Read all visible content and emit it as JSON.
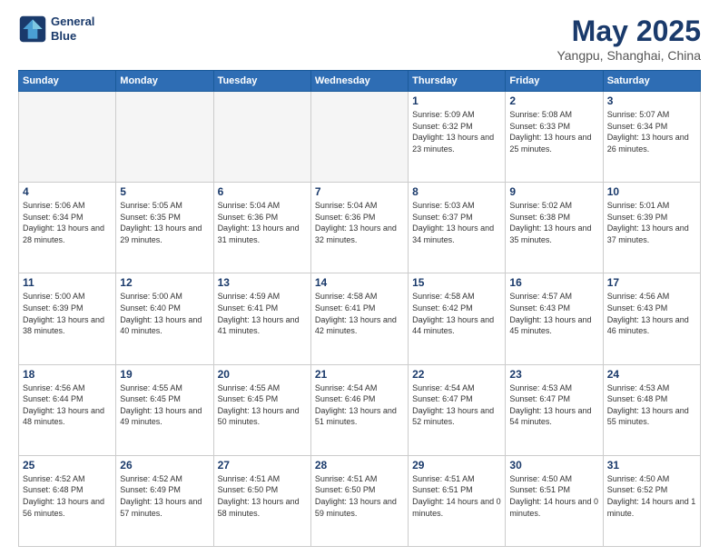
{
  "header": {
    "logo_line1": "General",
    "logo_line2": "Blue",
    "month": "May 2025",
    "location": "Yangpu, Shanghai, China"
  },
  "weekdays": [
    "Sunday",
    "Monday",
    "Tuesday",
    "Wednesday",
    "Thursday",
    "Friday",
    "Saturday"
  ],
  "weeks": [
    [
      {
        "day": "",
        "empty": true
      },
      {
        "day": "",
        "empty": true
      },
      {
        "day": "",
        "empty": true
      },
      {
        "day": "",
        "empty": true
      },
      {
        "day": "1",
        "sunrise": "Sunrise: 5:09 AM",
        "sunset": "Sunset: 6:32 PM",
        "daylight": "Daylight: 13 hours and 23 minutes."
      },
      {
        "day": "2",
        "sunrise": "Sunrise: 5:08 AM",
        "sunset": "Sunset: 6:33 PM",
        "daylight": "Daylight: 13 hours and 25 minutes."
      },
      {
        "day": "3",
        "sunrise": "Sunrise: 5:07 AM",
        "sunset": "Sunset: 6:34 PM",
        "daylight": "Daylight: 13 hours and 26 minutes."
      }
    ],
    [
      {
        "day": "4",
        "sunrise": "Sunrise: 5:06 AM",
        "sunset": "Sunset: 6:34 PM",
        "daylight": "Daylight: 13 hours and 28 minutes."
      },
      {
        "day": "5",
        "sunrise": "Sunrise: 5:05 AM",
        "sunset": "Sunset: 6:35 PM",
        "daylight": "Daylight: 13 hours and 29 minutes."
      },
      {
        "day": "6",
        "sunrise": "Sunrise: 5:04 AM",
        "sunset": "Sunset: 6:36 PM",
        "daylight": "Daylight: 13 hours and 31 minutes."
      },
      {
        "day": "7",
        "sunrise": "Sunrise: 5:04 AM",
        "sunset": "Sunset: 6:36 PM",
        "daylight": "Daylight: 13 hours and 32 minutes."
      },
      {
        "day": "8",
        "sunrise": "Sunrise: 5:03 AM",
        "sunset": "Sunset: 6:37 PM",
        "daylight": "Daylight: 13 hours and 34 minutes."
      },
      {
        "day": "9",
        "sunrise": "Sunrise: 5:02 AM",
        "sunset": "Sunset: 6:38 PM",
        "daylight": "Daylight: 13 hours and 35 minutes."
      },
      {
        "day": "10",
        "sunrise": "Sunrise: 5:01 AM",
        "sunset": "Sunset: 6:39 PM",
        "daylight": "Daylight: 13 hours and 37 minutes."
      }
    ],
    [
      {
        "day": "11",
        "sunrise": "Sunrise: 5:00 AM",
        "sunset": "Sunset: 6:39 PM",
        "daylight": "Daylight: 13 hours and 38 minutes."
      },
      {
        "day": "12",
        "sunrise": "Sunrise: 5:00 AM",
        "sunset": "Sunset: 6:40 PM",
        "daylight": "Daylight: 13 hours and 40 minutes."
      },
      {
        "day": "13",
        "sunrise": "Sunrise: 4:59 AM",
        "sunset": "Sunset: 6:41 PM",
        "daylight": "Daylight: 13 hours and 41 minutes."
      },
      {
        "day": "14",
        "sunrise": "Sunrise: 4:58 AM",
        "sunset": "Sunset: 6:41 PM",
        "daylight": "Daylight: 13 hours and 42 minutes."
      },
      {
        "day": "15",
        "sunrise": "Sunrise: 4:58 AM",
        "sunset": "Sunset: 6:42 PM",
        "daylight": "Daylight: 13 hours and 44 minutes."
      },
      {
        "day": "16",
        "sunrise": "Sunrise: 4:57 AM",
        "sunset": "Sunset: 6:43 PM",
        "daylight": "Daylight: 13 hours and 45 minutes."
      },
      {
        "day": "17",
        "sunrise": "Sunrise: 4:56 AM",
        "sunset": "Sunset: 6:43 PM",
        "daylight": "Daylight: 13 hours and 46 minutes."
      }
    ],
    [
      {
        "day": "18",
        "sunrise": "Sunrise: 4:56 AM",
        "sunset": "Sunset: 6:44 PM",
        "daylight": "Daylight: 13 hours and 48 minutes."
      },
      {
        "day": "19",
        "sunrise": "Sunrise: 4:55 AM",
        "sunset": "Sunset: 6:45 PM",
        "daylight": "Daylight: 13 hours and 49 minutes."
      },
      {
        "day": "20",
        "sunrise": "Sunrise: 4:55 AM",
        "sunset": "Sunset: 6:45 PM",
        "daylight": "Daylight: 13 hours and 50 minutes."
      },
      {
        "day": "21",
        "sunrise": "Sunrise: 4:54 AM",
        "sunset": "Sunset: 6:46 PM",
        "daylight": "Daylight: 13 hours and 51 minutes."
      },
      {
        "day": "22",
        "sunrise": "Sunrise: 4:54 AM",
        "sunset": "Sunset: 6:47 PM",
        "daylight": "Daylight: 13 hours and 52 minutes."
      },
      {
        "day": "23",
        "sunrise": "Sunrise: 4:53 AM",
        "sunset": "Sunset: 6:47 PM",
        "daylight": "Daylight: 13 hours and 54 minutes."
      },
      {
        "day": "24",
        "sunrise": "Sunrise: 4:53 AM",
        "sunset": "Sunset: 6:48 PM",
        "daylight": "Daylight: 13 hours and 55 minutes."
      }
    ],
    [
      {
        "day": "25",
        "sunrise": "Sunrise: 4:52 AM",
        "sunset": "Sunset: 6:48 PM",
        "daylight": "Daylight: 13 hours and 56 minutes."
      },
      {
        "day": "26",
        "sunrise": "Sunrise: 4:52 AM",
        "sunset": "Sunset: 6:49 PM",
        "daylight": "Daylight: 13 hours and 57 minutes."
      },
      {
        "day": "27",
        "sunrise": "Sunrise: 4:51 AM",
        "sunset": "Sunset: 6:50 PM",
        "daylight": "Daylight: 13 hours and 58 minutes."
      },
      {
        "day": "28",
        "sunrise": "Sunrise: 4:51 AM",
        "sunset": "Sunset: 6:50 PM",
        "daylight": "Daylight: 13 hours and 59 minutes."
      },
      {
        "day": "29",
        "sunrise": "Sunrise: 4:51 AM",
        "sunset": "Sunset: 6:51 PM",
        "daylight": "Daylight: 14 hours and 0 minutes."
      },
      {
        "day": "30",
        "sunrise": "Sunrise: 4:50 AM",
        "sunset": "Sunset: 6:51 PM",
        "daylight": "Daylight: 14 hours and 0 minutes."
      },
      {
        "day": "31",
        "sunrise": "Sunrise: 4:50 AM",
        "sunset": "Sunset: 6:52 PM",
        "daylight": "Daylight: 14 hours and 1 minute."
      }
    ]
  ]
}
